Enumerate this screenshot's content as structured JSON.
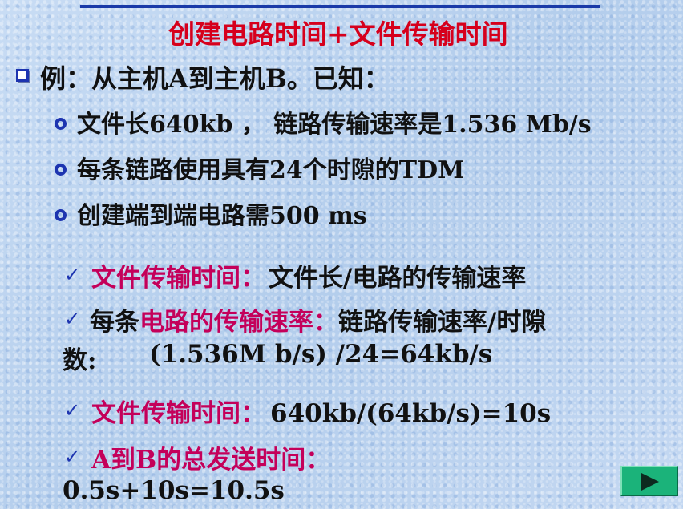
{
  "slide": {
    "title": "创建电路时间+文件传输时间",
    "example_intro": "例：从主机A到主机B。已知：",
    "givens": [
      "文件长640kb ， 链路传输速率是1.536 Mb/s",
      "每条链路使用具有24个时隙的TDM",
      "创建端到端电路需500 ms"
    ],
    "steps": {
      "s1_label": "文件传输时间：",
      "s1_text": "文件长/电路的传输速率",
      "s2_prefix": "每条",
      "s2_label": "电路的传输速率：",
      "s2_text": "链路传输速率/时隙",
      "s2_line2_left": "数:",
      "s2_line2_formula": "(1.536M b/s) /24=64kb/s",
      "s3_label": "文件传输时间：",
      "s3_text": "640kb/(64kb/s)=10s",
      "s4_label": "A到B的总发送时间：",
      "s4_result": "0.5s+10s=10.5s"
    },
    "check_glyph": "✓"
  },
  "nav": {
    "next_icon": "play-next-icon"
  },
  "colors": {
    "title": "#d6001c",
    "accent": "#c4005a",
    "bullet": "#1d34b0",
    "nav": "#1bb37a"
  }
}
